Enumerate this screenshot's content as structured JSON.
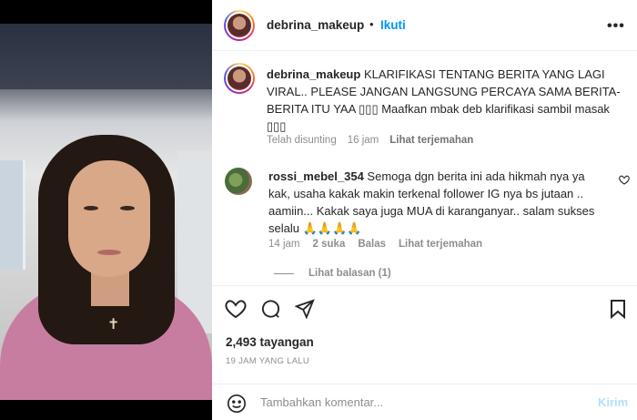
{
  "header": {
    "username": "debrina_makeup",
    "dot": "•",
    "follow_label": "Ikuti",
    "more_icon": "more-icon"
  },
  "caption": {
    "username": "debrina_makeup",
    "text": "KLARIFIKASI TENTANG BERITA YANG LAGI VIRAL.. PLEASE JANGAN LANGSUNG PERCAYA SAMA BERITA-BERITA ITU YAA ▯▯▯ Maafkan mbak deb klarifikasi sambil masak ▯▯▯",
    "edited": "Telah disunting",
    "time": "16 jam",
    "translate": "Lihat terjemahan"
  },
  "comment": {
    "username": "rossi_mebel_354",
    "text": "Semoga dgn berita ini ada hikmah nya ya kak, usaha kakak makin terkenal follower IG nya bs jutaan .. aamiin... Kakak saya juga MUA di karanganyar.. salam sukses selalu 🙏🙏🙏🙏",
    "time": "14 jam",
    "likes": "2 suka",
    "reply": "Balas",
    "translate": "Lihat terjemahan",
    "view_replies": "Lihat balasan (1)"
  },
  "post": {
    "views": "2,493 tayangan",
    "date": "19 JAM YANG LALU"
  },
  "add_comment": {
    "placeholder": "Tambahkan komentar...",
    "send_label": "Kirim"
  }
}
